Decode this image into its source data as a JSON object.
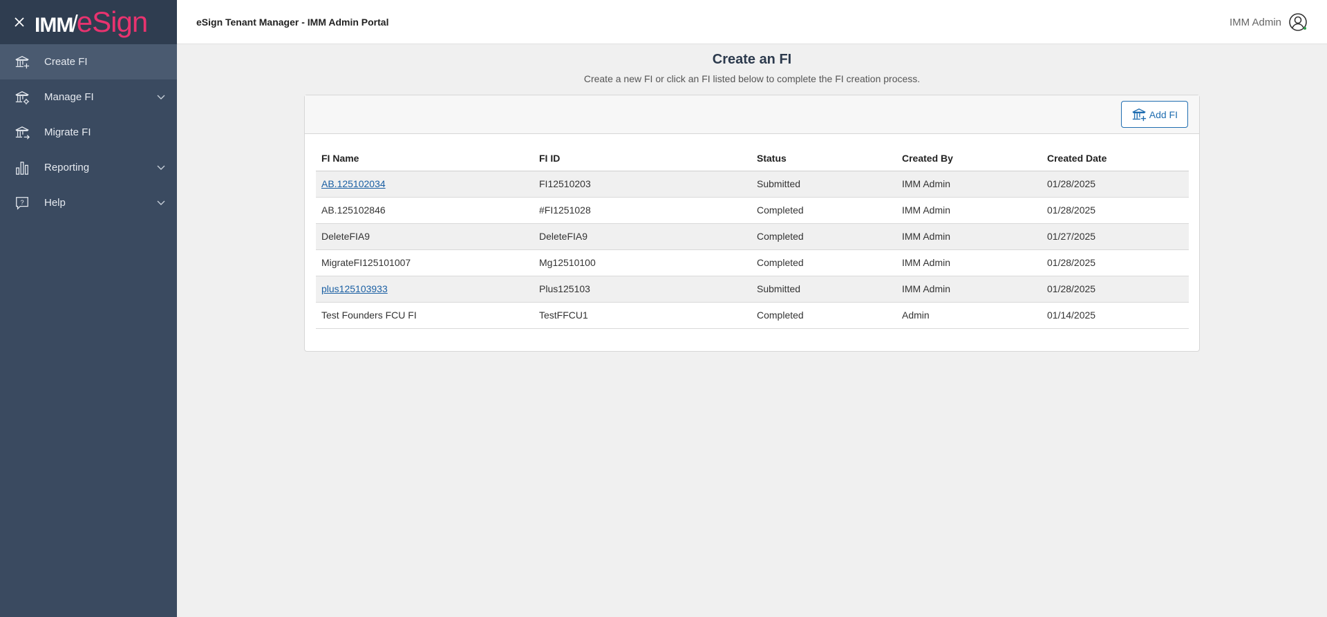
{
  "app": {
    "logo_primary": "IMM",
    "logo_secondary": "eSign",
    "title": "eSign Tenant Manager - IMM Admin Portal",
    "user_name": "IMM Admin"
  },
  "sidebar": {
    "items": [
      {
        "label": "Create FI",
        "icon": "bank-add-icon",
        "active": true,
        "has_children": false
      },
      {
        "label": "Manage FI",
        "icon": "bank-settings-icon",
        "active": false,
        "has_children": true
      },
      {
        "label": "Migrate FI",
        "icon": "bank-migrate-icon",
        "active": false,
        "has_children": false
      },
      {
        "label": "Reporting",
        "icon": "bar-chart-icon",
        "active": false,
        "has_children": true
      },
      {
        "label": "Help",
        "icon": "help-bubble-icon",
        "active": false,
        "has_children": true
      }
    ]
  },
  "main": {
    "title": "Create an FI",
    "subtitle": "Create a new FI or click an FI listed below to complete the FI creation process.",
    "add_button_label": "Add FI",
    "table": {
      "columns": [
        "FI Name",
        "FI ID",
        "Status",
        "Created By",
        "Created Date"
      ],
      "rows": [
        {
          "name": "AB.125102034",
          "link": true,
          "id": "FI12510203",
          "status": "Submitted",
          "created_by": "IMM Admin",
          "created_date": "01/28/2025"
        },
        {
          "name": "AB.125102846",
          "link": false,
          "id": "#FI1251028",
          "status": "Completed",
          "created_by": "IMM Admin",
          "created_date": "01/28/2025"
        },
        {
          "name": "DeleteFIA9",
          "link": false,
          "id": "DeleteFIA9",
          "status": "Completed",
          "created_by": "IMM Admin",
          "created_date": "01/27/2025"
        },
        {
          "name": "MigrateFI125101007",
          "link": false,
          "id": "Mg12510100",
          "status": "Completed",
          "created_by": "IMM Admin",
          "created_date": "01/28/2025"
        },
        {
          "name": "plus125103933",
          "link": true,
          "id": "Plus125103",
          "status": "Submitted",
          "created_by": "IMM Admin",
          "created_date": "01/28/2025"
        },
        {
          "name": "Test Founders FCU FI",
          "link": false,
          "id": "TestFFCU1",
          "status": "Completed",
          "created_by": "Admin",
          "created_date": "01/14/2025"
        }
      ]
    }
  },
  "colors": {
    "sidebar_bg": "#3a4a60",
    "sidebar_active": "#4a5a70",
    "link": "#1a5fa3",
    "accent_button": "#1f6db0",
    "logo_pink": "#e8336f",
    "logo_purple": "#a044c8"
  }
}
